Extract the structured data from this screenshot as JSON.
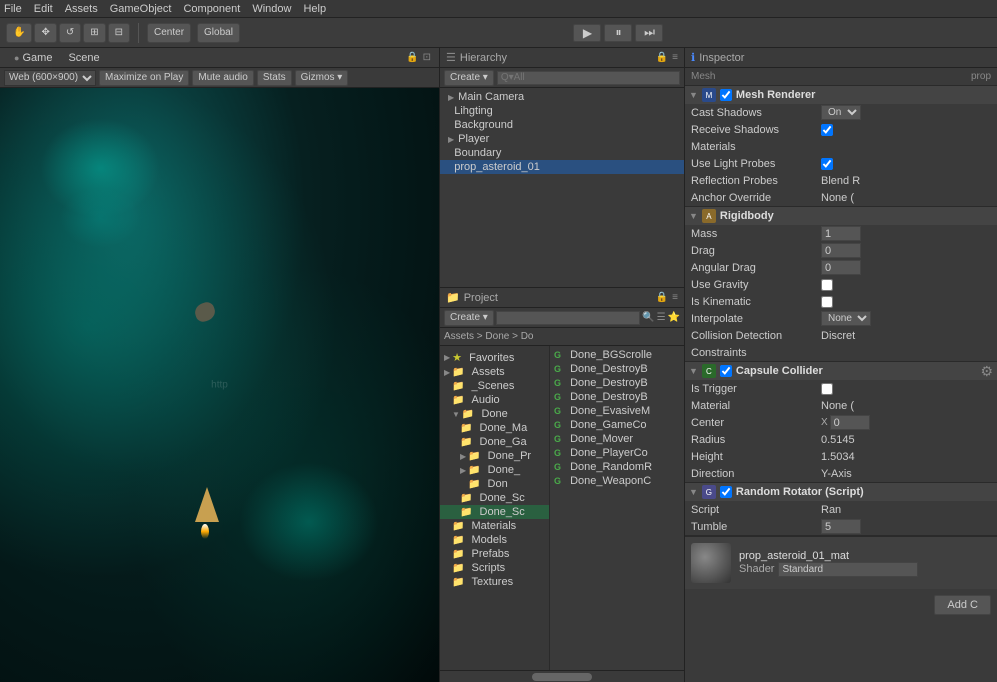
{
  "menubar": {
    "items": [
      "File",
      "Edit",
      "Assets",
      "GameObject",
      "Component",
      "Window",
      "Help"
    ]
  },
  "toolbar": {
    "hand_label": "✋",
    "move_label": "✥",
    "rotate_label": "↺",
    "scale_label": "⊞",
    "rect_label": "⊟",
    "center_label": "Center",
    "global_label": "Global",
    "play_label": "▶",
    "pause_label": "⏸",
    "step_label": "⏭"
  },
  "game_panel": {
    "tab_game": "Game",
    "tab_scene": "Scene",
    "resolution": "Web (600×900)",
    "maximize": "Maximize on Play",
    "mute": "Mute audio",
    "stats": "Stats",
    "gizmos": "Gizmos ▾",
    "watermark": "http"
  },
  "hierarchy": {
    "title": "Hierarchy",
    "create_btn": "Create ▾",
    "search_placeholder": "Q▾All",
    "items": [
      {
        "label": "Main Camera",
        "indent": 0
      },
      {
        "label": "Lihgting",
        "indent": 0
      },
      {
        "label": "Background",
        "indent": 0
      },
      {
        "label": "Player",
        "indent": 0
      },
      {
        "label": "Boundary",
        "indent": 0
      },
      {
        "label": "prop_asteroid_01",
        "indent": 0,
        "selected": true
      }
    ]
  },
  "project": {
    "title": "Project",
    "create_btn": "Create ▾",
    "search_placeholder": "",
    "breadcrumb": "Assets > Done > Do",
    "favorites": "Favorites",
    "tree": [
      {
        "label": "Assets",
        "indent": 0
      },
      {
        "label": "_Scenes",
        "indent": 1
      },
      {
        "label": "Audio",
        "indent": 1
      },
      {
        "label": "Done",
        "indent": 1
      },
      {
        "label": "Done_Ma",
        "indent": 2
      },
      {
        "label": "Done_Ga",
        "indent": 2
      },
      {
        "label": "Done_Pr",
        "indent": 2
      },
      {
        "label": "Done_",
        "indent": 2
      },
      {
        "label": "Don",
        "indent": 3
      },
      {
        "label": "Done_Sc",
        "indent": 2
      },
      {
        "label": "Done_Sc",
        "indent": 2,
        "selected": true
      },
      {
        "label": "Materials",
        "indent": 1
      },
      {
        "label": "Models",
        "indent": 1
      },
      {
        "label": "Prefabs",
        "indent": 1
      },
      {
        "label": "Scripts",
        "indent": 1
      },
      {
        "label": "Textures",
        "indent": 1
      }
    ],
    "files": [
      {
        "label": "Done_BGScrolle"
      },
      {
        "label": "Done_DestroyB"
      },
      {
        "label": "Done_DestroyB"
      },
      {
        "label": "Done_DestroyB"
      },
      {
        "label": "Done_EvasiveM"
      },
      {
        "label": "Done_GameCo"
      },
      {
        "label": "Done_Mover"
      },
      {
        "label": "Done_PlayerCo"
      },
      {
        "label": "Done_RandomR"
      },
      {
        "label": "Done_WeaponC"
      }
    ]
  },
  "inspector": {
    "title": "Inspector",
    "mesh_label": "Mesh",
    "prop_label": "prop",
    "sections": {
      "mesh_renderer": {
        "title": "Mesh Renderer",
        "cast_shadows": "Cast Shadows",
        "cast_shadows_val": "On",
        "receive_shadows": "Receive Shadows",
        "materials": "Materials",
        "use_light_probes": "Use Light Probes",
        "reflection_probes": "Reflection Probes",
        "reflection_probes_val": "Blend R",
        "anchor_override": "Anchor Override",
        "anchor_override_val": "None ("
      },
      "rigidbody": {
        "title": "Rigidbody",
        "mass": "Mass",
        "mass_val": "1",
        "drag": "Drag",
        "drag_val": "0",
        "angular_drag": "Angular Drag",
        "angular_drag_val": "0",
        "use_gravity": "Use Gravity",
        "is_kinematic": "Is Kinematic",
        "interpolate": "Interpolate",
        "interpolate_val": "None",
        "collision_detection": "Collision Detection",
        "collision_detection_val": "Discret",
        "constraints": "Constraints"
      },
      "capsule_collider": {
        "title": "Capsule Collider",
        "is_trigger": "Is Trigger",
        "material": "Material",
        "material_val": "None (",
        "center": "Center",
        "center_x": "X",
        "center_x_val": "0",
        "radius": "Radius",
        "radius_val": "0.5145",
        "height": "Height",
        "height_val": "1.5034",
        "direction": "Direction",
        "direction_val": "Y-Axis"
      },
      "random_rotator": {
        "title": "Random Rotator (Script)",
        "script": "Script",
        "script_val": "Ran",
        "tumble": "Tumble",
        "tumble_val": "5"
      }
    },
    "material": {
      "name": "prop_asteroid_01_mat",
      "shader_label": "Shader",
      "shader_val": "Standard"
    },
    "add_component": "Add C"
  }
}
